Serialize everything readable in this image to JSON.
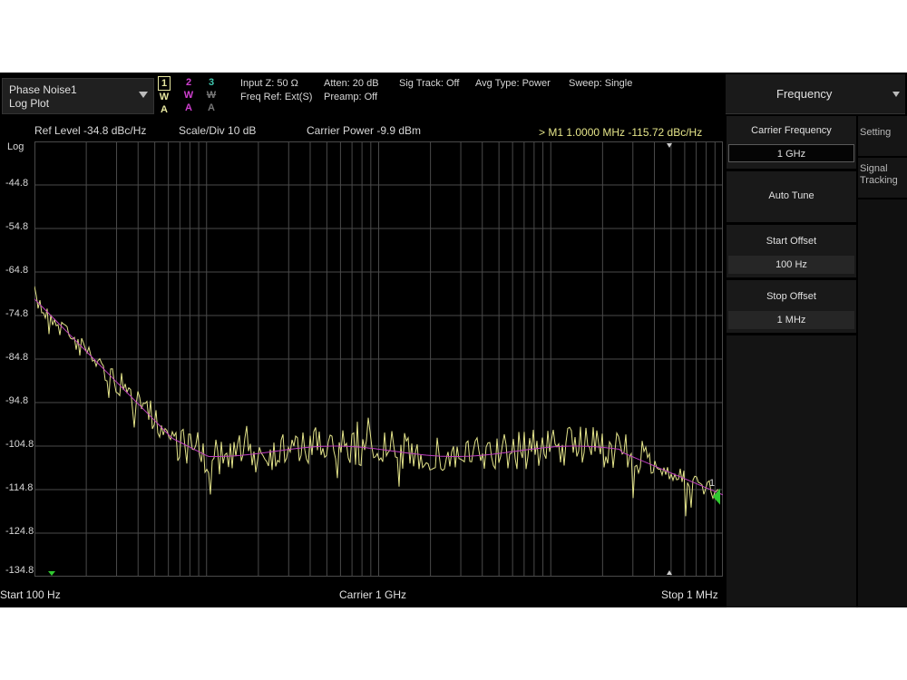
{
  "header": {
    "mode_name": "Phase Noise1",
    "mode_view": "Log Plot",
    "traces": [
      {
        "num": "1",
        "type": "W",
        "det": "A",
        "color": "#e8e8a0"
      },
      {
        "num": "2",
        "type": "W",
        "det": "A",
        "color": "#d040d0"
      },
      {
        "num": "3",
        "type": "W",
        "det": "A",
        "color": "#40c8b0"
      }
    ],
    "input_z": "Input Z: 50 Ω",
    "freq_ref": "Freq Ref: Ext(S)",
    "atten": "Atten: 20 dB",
    "preamp": "Preamp: Off",
    "sig_track": "Sig Track: Off",
    "avg_type": "Avg Type: Power",
    "sweep": "Sweep: Single"
  },
  "refrow": {
    "ref_level": "Ref Level  -34.8 dBc/Hz",
    "scale_div": "Scale/Div  10 dB",
    "carrier_power": "Carrier Power  -9.9 dBm",
    "marker": "> M1   1.0000 MHz   -115.72 dBc/Hz"
  },
  "plot": {
    "scale_type": "Log",
    "y_labels": [
      "-44.8",
      "-54.8",
      "-64.8",
      "-74.8",
      "-84.8",
      "-94.8",
      "-104.8",
      "-114.8",
      "-124.8",
      "-134.8"
    ],
    "marker_label": "1",
    "colors": {
      "trace1": "#e4e48a",
      "trace2": "#c040c0",
      "grid": "#4a4a4a",
      "marker": "#30c830"
    }
  },
  "bottom": {
    "start": "Start  100 Hz",
    "center": "Carrier  1 GHz",
    "stop": "Stop  1 MHz"
  },
  "menu": {
    "title": "Frequency",
    "softkeys": {
      "carrier_label": "Carrier Frequency",
      "carrier_value": "1 GHz",
      "auto_tune": "Auto Tune",
      "start_label": "Start Offset",
      "start_value": "100 Hz",
      "stop_label": "Stop Offset",
      "stop_value": "1 MHz"
    },
    "tabs": {
      "setting": "Setting",
      "signal_tracking": "Signal Tracking"
    }
  }
}
